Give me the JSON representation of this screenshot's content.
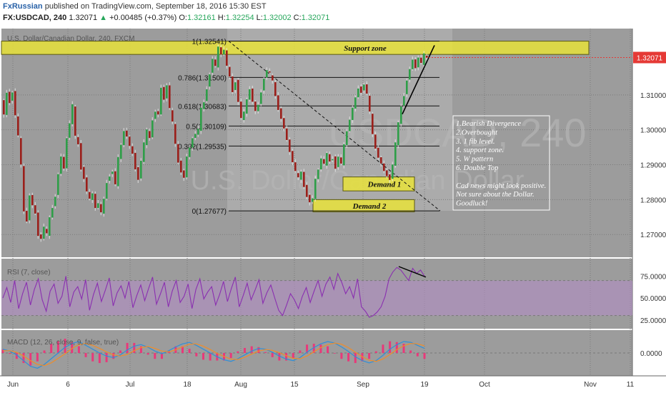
{
  "header": {
    "author": "FxRussian",
    "published": "published on TradingView.com, September 18, 2016 15:30 EST",
    "symbol": "FX:USDCAD, 240",
    "last": "1.32071",
    "change": "+0.00485 (+0.37%)",
    "up_arrow": "▲",
    "ohlc": [
      {
        "label": "O:",
        "value": "1.32161"
      },
      {
        "label": "H:",
        "value": "1.32254"
      },
      {
        "label": "L:",
        "value": "1.32002"
      },
      {
        "label": "C:",
        "value": "1.32071"
      }
    ]
  },
  "colors": {
    "pane_bg": "#9c9c9c",
    "bull": "#2e9e48",
    "bear": "#9b1f1a",
    "zone_fill": "#e8e23a",
    "rsi_line": "#8a2fb0",
    "rsi_band": "#b48cc8",
    "macd_line": "#2f8fd8",
    "signal_line": "#f08c28",
    "hist": "#e8397a",
    "price_tag": "#e53935"
  },
  "chart_data": [
    {
      "type": "candlestick",
      "title": "U.S. Dollar/Canadian Dollar, 240, FXCM",
      "watermark": "USDCAD, 240",
      "watermark_sub": "U.S. Dollar/Canadian Dollar",
      "y_ticks": [
        "1.31000",
        "1.30000",
        "1.29000",
        "1.28000",
        "1.27000"
      ],
      "ylim": [
        1.2635,
        1.329
      ],
      "current_price": "1.32071",
      "x_ticks": [
        "Jun",
        "6",
        "Jul",
        "18",
        "Aug",
        "15",
        "Sep",
        "19",
        "Oct",
        "Nov",
        "11"
      ],
      "series": {
        "points": [
          [
            0,
            1.3085
          ],
          [
            4,
            1.304
          ],
          [
            8,
            1.3105
          ],
          [
            12,
            1.308
          ],
          [
            16,
            1.311
          ],
          [
            20,
            1.304
          ],
          [
            24,
            1.298
          ],
          [
            28,
            1.29
          ],
          [
            32,
            1.277
          ],
          [
            36,
            1.274
          ],
          [
            40,
            1.281
          ],
          [
            44,
            1.278
          ],
          [
            48,
            1.276
          ],
          [
            52,
            1.27
          ],
          [
            56,
            1.269
          ],
          [
            60,
            1.272
          ],
          [
            64,
            1.27
          ],
          [
            68,
            1.275
          ],
          [
            72,
            1.278
          ],
          [
            76,
            1.281
          ],
          [
            80,
            1.287
          ],
          [
            84,
            1.292
          ],
          [
            88,
            1.289
          ],
          [
            92,
            1.298
          ],
          [
            96,
            1.302
          ],
          [
            100,
            1.307
          ],
          [
            104,
            1.298
          ],
          [
            108,
            1.296
          ],
          [
            112,
            1.289
          ],
          [
            116,
            1.286
          ],
          [
            120,
            1.282
          ],
          [
            124,
            1.28
          ],
          [
            128,
            1.282
          ],
          [
            132,
            1.278
          ],
          [
            136,
            1.279
          ],
          [
            140,
            1.276
          ],
          [
            144,
            1.28
          ],
          [
            148,
            1.285
          ],
          [
            152,
            1.287
          ],
          [
            156,
            1.288
          ],
          [
            160,
            1.284
          ],
          [
            164,
            1.292
          ],
          [
            168,
            1.296
          ],
          [
            172,
            1.3
          ],
          [
            176,
            1.298
          ],
          [
            180,
            1.295
          ],
          [
            184,
            1.293
          ],
          [
            188,
            1.289
          ],
          [
            192,
            1.286
          ],
          [
            196,
            1.291
          ],
          [
            200,
            1.296
          ],
          [
            204,
            1.3
          ],
          [
            208,
            1.298
          ],
          [
            212,
            1.303
          ],
          [
            216,
            1.305
          ],
          [
            220,
            1.304
          ],
          [
            224,
            1.312
          ],
          [
            228,
            1.309
          ],
          [
            232,
            1.313
          ],
          [
            236,
            1.306
          ],
          [
            240,
            1.302
          ],
          [
            244,
            1.296
          ],
          [
            248,
            1.291
          ],
          [
            252,
            1.288
          ],
          [
            256,
            1.286
          ],
          [
            260,
            1.292
          ],
          [
            264,
            1.295
          ],
          [
            268,
            1.298
          ],
          [
            272,
            1.299
          ],
          [
            276,
            1.3
          ],
          [
            280,
            1.306
          ],
          [
            284,
            1.308
          ],
          [
            288,
            1.312
          ],
          [
            292,
            1.316
          ],
          [
            296,
            1.32
          ],
          [
            300,
            1.318
          ],
          [
            304,
            1.324
          ],
          [
            308,
            1.322
          ],
          [
            312,
            1.323
          ],
          [
            316,
            1.318
          ],
          [
            320,
            1.315
          ],
          [
            324,
            1.311
          ],
          [
            328,
            1.314
          ],
          [
            332,
            1.308
          ],
          [
            336,
            1.303
          ],
          [
            340,
            1.305
          ],
          [
            344,
            1.309
          ],
          [
            348,
            1.312
          ],
          [
            352,
            1.308
          ],
          [
            356,
            1.305
          ],
          [
            360,
            1.307
          ],
          [
            364,
            1.311
          ],
          [
            368,
            1.315
          ],
          [
            372,
            1.317
          ],
          [
            376,
            1.316
          ],
          [
            380,
            1.314
          ],
          [
            384,
            1.31
          ],
          [
            388,
            1.306
          ],
          [
            392,
            1.303
          ],
          [
            396,
            1.3
          ],
          [
            400,
            1.297
          ],
          [
            404,
            1.294
          ],
          [
            408,
            1.291
          ],
          [
            412,
            1.288
          ],
          [
            416,
            1.286
          ],
          [
            420,
            1.288
          ],
          [
            424,
            1.284
          ],
          [
            428,
            1.281
          ],
          [
            432,
            1.279
          ],
          [
            436,
            1.28
          ],
          [
            440,
            1.286
          ],
          [
            444,
            1.289
          ],
          [
            448,
            1.292
          ],
          [
            452,
            1.29
          ],
          [
            456,
            1.293
          ],
          [
            460,
            1.291
          ],
          [
            464,
            1.292
          ],
          [
            468,
            1.289
          ],
          [
            472,
            1.292
          ],
          [
            476,
            1.29
          ],
          [
            480,
            1.296
          ],
          [
            484,
            1.3
          ],
          [
            488,
            1.303
          ],
          [
            492,
            1.306
          ],
          [
            496,
            1.309
          ],
          [
            500,
            1.312
          ],
          [
            504,
            1.311
          ],
          [
            508,
            1.313
          ],
          [
            512,
            1.31
          ],
          [
            516,
            1.305
          ],
          [
            520,
            1.299
          ],
          [
            524,
            1.295
          ],
          [
            528,
            1.292
          ],
          [
            532,
            1.29
          ],
          [
            536,
            1.288
          ],
          [
            540,
            1.287
          ],
          [
            544,
            1.286
          ],
          [
            548,
            1.29
          ],
          [
            552,
            1.296
          ],
          [
            556,
            1.302
          ],
          [
            560,
            1.307
          ],
          [
            564,
            1.31
          ],
          [
            568,
            1.314
          ],
          [
            572,
            1.317
          ],
          [
            576,
            1.32
          ],
          [
            580,
            1.318
          ],
          [
            584,
            1.321
          ],
          [
            588,
            1.319
          ],
          [
            592,
            1.3215
          ],
          [
            594,
            1.3207
          ]
        ]
      },
      "fib_levels": [
        {
          "label": "1(1.32541)",
          "value": 1.32541
        },
        {
          "label": "0.786(1.31500)",
          "value": 1.315
        },
        {
          "label": "0.618(1.30683)",
          "value": 1.30683
        },
        {
          "label": "0.5(1.30109)",
          "value": 1.30109
        },
        {
          "label": "0.382(1.29535)",
          "value": 1.29535
        },
        {
          "label": "0(1.27677)",
          "value": 1.27677
        }
      ],
      "zones": [
        {
          "label": "Support zone",
          "x0": 0,
          "x1": 822,
          "y0": 1.3216,
          "y1": 1.3254
        },
        {
          "label": "Demand 1",
          "x0": 478,
          "x1": 578,
          "y0": 1.2825,
          "y1": 1.2865
        },
        {
          "label": "Demand 2",
          "x0": 436,
          "x1": 578,
          "y0": 1.2765,
          "y1": 1.28
        }
      ],
      "annotations": [
        "1.Bearish Divergence",
        "2.Overbought",
        "3. 1 fib level.",
        "4. support zone.",
        "5. W pattern",
        "6. Double Top",
        "",
        "Cad news might look positive.",
        "Not sure about the Dollar.",
        "Goodluck!"
      ]
    },
    {
      "type": "line",
      "title": "RSI (7, close)",
      "ylim": [
        15,
        95
      ],
      "y_ticks": [
        "75.0000",
        "50.0000",
        "25.0000"
      ],
      "bands": [
        30,
        70
      ],
      "series": [
        {
          "values": [
            50,
            62,
            45,
            70,
            38,
            55,
            68,
            42,
            60,
            72,
            48,
            35,
            58,
            66,
            44,
            52,
            75,
            40,
            57,
            63,
            49,
            71,
            36,
            54,
            67,
            46,
            59,
            73,
            41,
            56,
            64,
            50,
            69,
            39,
            53,
            65,
            47,
            61,
            74,
            43,
            55,
            68,
            40,
            58,
            70,
            45,
            52,
            66,
            38,
            60,
            72,
            49,
            57,
            63,
            42,
            54,
            69,
            46,
            61,
            74,
            40,
            53,
            67,
            48,
            59,
            71,
            44,
            56,
            65,
            50,
            36,
            30,
            42,
            55,
            48,
            38,
            52,
            62,
            45,
            58,
            70,
            52,
            66,
            74,
            60,
            78,
            68,
            55,
            63,
            50,
            72,
            40,
            35,
            28,
            30,
            34,
            40,
            52,
            72,
            80,
            85,
            82,
            76,
            70,
            84,
            78,
            82,
            75
          ]
        }
      ]
    },
    {
      "type": "line",
      "title": "MACD (12, 26, close, 9, false, true)",
      "ylim": [
        -0.006,
        0.006
      ],
      "y_ticks": [
        "0.0000"
      ],
      "series": [
        {
          "values": [
            0.001,
            0.0005,
            -0.0005,
            -0.002,
            -0.0035,
            -0.004,
            -0.003,
            -0.0015,
            0.0,
            0.0015,
            0.0025,
            0.003,
            0.002,
            0.001,
            0.0,
            -0.0008,
            -0.0012,
            -0.0005,
            0.0008,
            0.0018,
            0.0022,
            0.0015,
            0.0005,
            -0.0002,
            0.0006,
            0.0016,
            0.0024,
            0.0028,
            0.002,
            0.001,
            0.0,
            -0.001,
            -0.0018,
            -0.0022,
            -0.0015,
            -0.0005,
            0.0005,
            0.0012,
            0.001,
            0.0002,
            -0.0008,
            -0.0016,
            -0.002,
            -0.0012,
            0.0002,
            0.0014,
            0.0024,
            0.003,
            0.0026,
            0.0016,
            0.0004,
            -0.001,
            -0.002,
            -0.0026,
            -0.002,
            -0.0006,
            0.001,
            0.0022,
            0.003,
            0.0028,
            0.002,
            0.0012
          ]
        },
        {
          "values": [
            0.0006,
            0.0006,
            0.0002,
            -0.0008,
            -0.002,
            -0.003,
            -0.0033,
            -0.0026,
            -0.0014,
            -0.0002,
            0.0012,
            0.0022,
            0.0025,
            0.002,
            0.0012,
            0.0003,
            -0.0005,
            -0.0008,
            -0.0004,
            0.0006,
            0.0014,
            0.0017,
            0.0012,
            0.0005,
            0.0003,
            0.0008,
            0.0016,
            0.0023,
            0.0024,
            0.0018,
            0.0009,
            -0.0001,
            -0.0009,
            -0.0016,
            -0.0017,
            -0.0011,
            -0.0003,
            0.0005,
            0.0009,
            0.0007,
            0.0001,
            -0.0007,
            -0.0014,
            -0.0015,
            -0.0008,
            0.0003,
            0.0014,
            0.0022,
            0.0026,
            0.0023,
            0.0014,
            0.0002,
            -0.001,
            -0.0019,
            -0.0022,
            -0.0016,
            -0.0004,
            0.0009,
            0.0019,
            0.0025,
            0.0024,
            0.0019
          ]
        }
      ]
    }
  ]
}
